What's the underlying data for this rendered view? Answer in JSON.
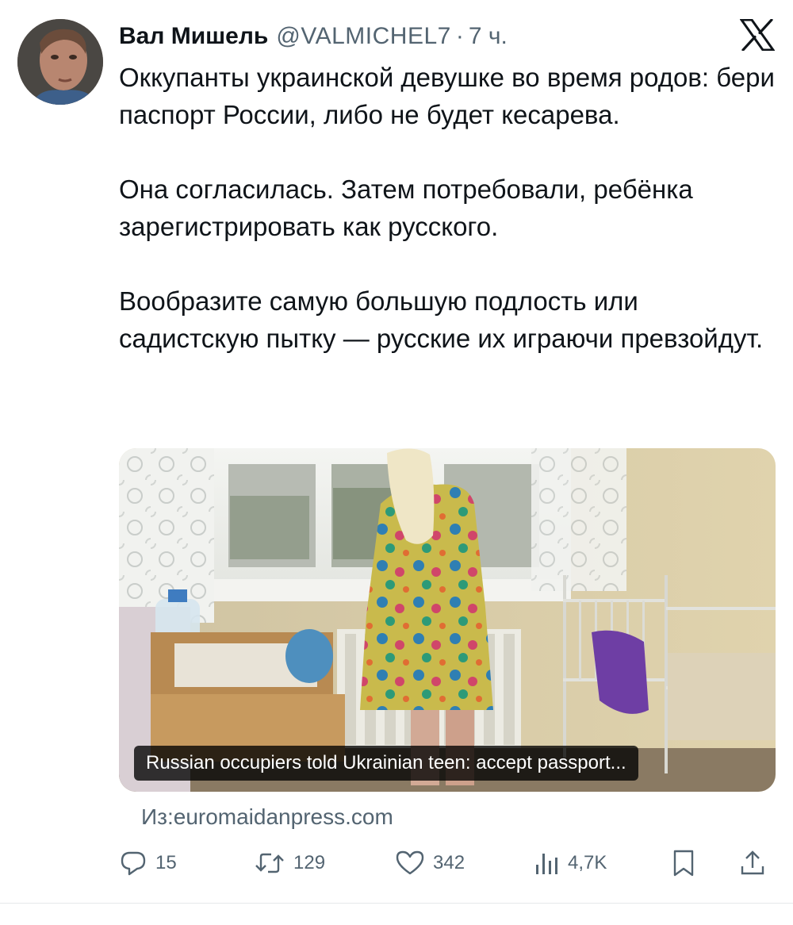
{
  "tweet": {
    "author_name": "Вал Мишель",
    "author_handle": "@VALMICHEL7",
    "separator": "·",
    "time": "7 ч.",
    "paragraphs": [
      "Оккупанты украинской девушке во время родов: бери паспорт России, либо не будет кесарева.",
      "Она согласилась. Затем потребовали, ребёнка зарегистрировать как русского.",
      "Вообразите самую большую подлость или садистскую пытку — русские их играючи превзойдут."
    ]
  },
  "media": {
    "caption": "Russian occupiers told Ukrainian teen: accept passport..."
  },
  "source": "Из:euromaidanpress.com",
  "actions": {
    "replies": "15",
    "retweets": "129",
    "likes": "342",
    "views": "4,7K"
  },
  "icons": {
    "platform": "x-logo-icon",
    "reply": "reply-icon",
    "retweet": "retweet-icon",
    "like": "heart-icon",
    "views": "views-icon",
    "bookmark": "bookmark-icon",
    "share": "share-icon"
  },
  "colors": {
    "text": "#0f1419",
    "secondary": "#536471",
    "caption_bg": "#000000"
  }
}
